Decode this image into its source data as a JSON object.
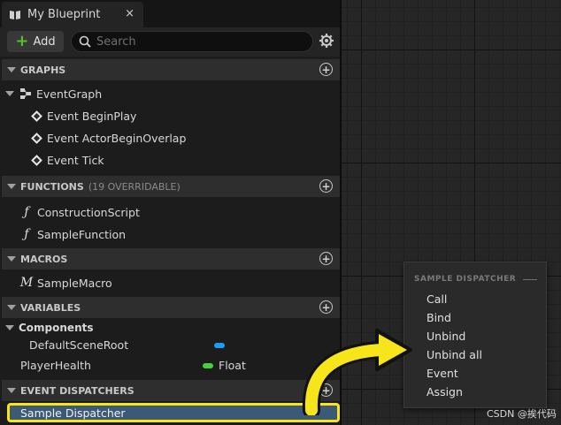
{
  "tab": {
    "title": "My Blueprint",
    "close": "×"
  },
  "toolbar": {
    "add_label": "Add",
    "search_placeholder": "Search"
  },
  "sections": {
    "graphs": {
      "label": "GRAPHS"
    },
    "functions": {
      "label": "FUNCTIONS",
      "sub": "(19 OVERRIDABLE)"
    },
    "macros": {
      "label": "MACROS"
    },
    "variables": {
      "label": "VARIABLES"
    },
    "dispatchers": {
      "label": "EVENT DISPATCHERS"
    }
  },
  "graphs": {
    "event_graph": "EventGraph",
    "events": [
      "Event BeginPlay",
      "Event ActorBeginOverlap",
      "Event Tick"
    ]
  },
  "functions": [
    "ConstructionScript",
    "SampleFunction"
  ],
  "macros": [
    "SampleMacro"
  ],
  "variables": {
    "components_label": "Components",
    "default_scene_root": "DefaultSceneRoot",
    "player_health": "PlayerHealth",
    "player_health_type": "Float"
  },
  "dispatchers": [
    "Sample Dispatcher"
  ],
  "menu": {
    "title": "SAMPLE DISPATCHER",
    "items": [
      "Call",
      "Bind",
      "Unbind",
      "Unbind all",
      "Event",
      "Assign"
    ]
  },
  "watermark": "CSDN @挨代码",
  "colors": {
    "highlight": "#f7e51c",
    "selection": "#3c5a78",
    "add_green": "#58c02e",
    "object_blue": "#1aa0f0",
    "float_green": "#45d13b"
  },
  "icons": [
    "book-icon",
    "plus-icon",
    "search-icon",
    "gear-icon",
    "add-circle-icon",
    "event-graph-icon",
    "event-diamond-icon",
    "function-icon",
    "macro-icon",
    "arrow-icon"
  ]
}
